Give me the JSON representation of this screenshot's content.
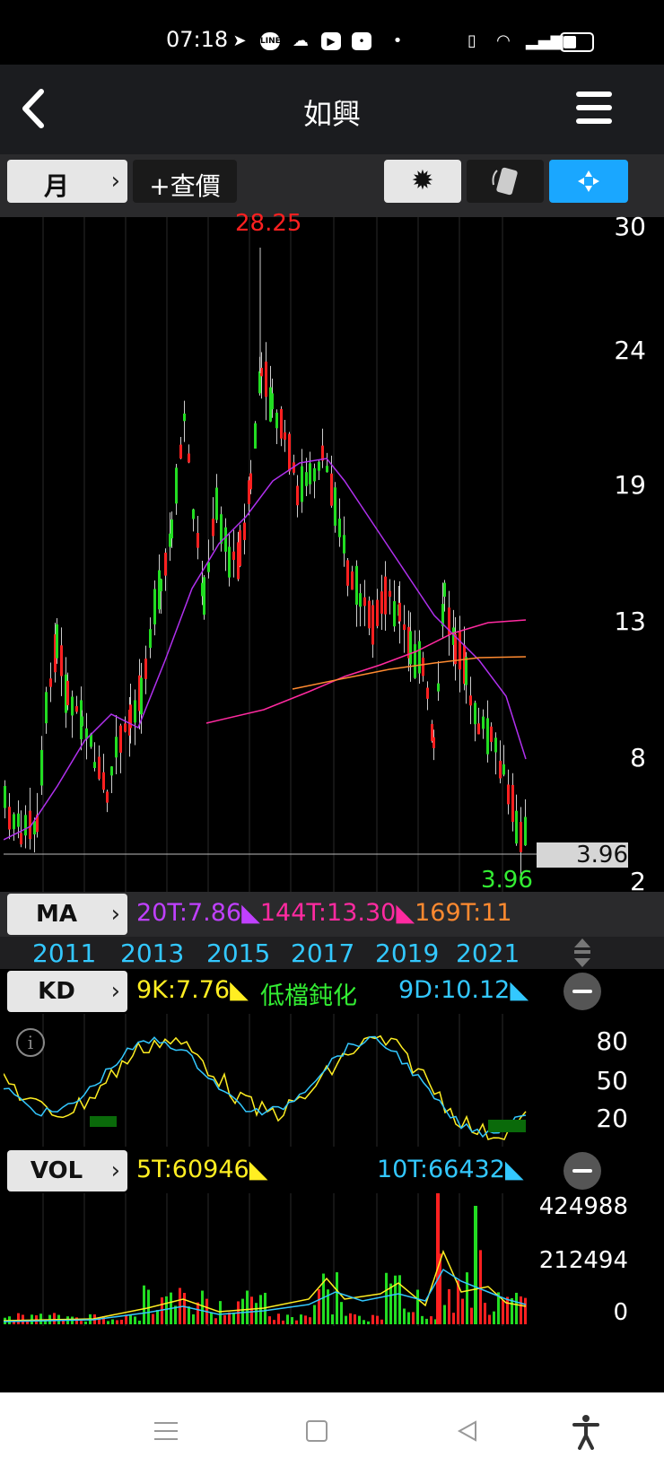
{
  "status": {
    "time": "07:18"
  },
  "header": {
    "title": "如興"
  },
  "toolbar": {
    "period_label": "月",
    "query_label": "+查價"
  },
  "price_chart": {
    "high_label": "28.25",
    "low_label": "3.96",
    "last_price": "3.96",
    "y_ticks": [
      "30",
      "24",
      "19",
      "13",
      "8",
      "2"
    ]
  },
  "ma": {
    "button_label": "MA",
    "values": [
      {
        "text": "20T:7.86",
        "color": "#c040ff"
      },
      {
        "text": "144T:13.30",
        "color": "#ff2aa0"
      },
      {
        "text": "169T:11",
        "color": "#ff8a30"
      }
    ]
  },
  "years": [
    "2011",
    "2013",
    "2015",
    "2017",
    "2019",
    "2021"
  ],
  "kd": {
    "button_label": "KD",
    "k_value": "9K:7.76",
    "status": "低檔鈍化",
    "d_value": "9D:10.12",
    "y_ticks": [
      "80",
      "50",
      "20"
    ]
  },
  "vol": {
    "button_label": "VOL",
    "ma5": "5T:60946",
    "ma10": "10T:66432",
    "y_ticks": [
      "424988",
      "212494",
      "0"
    ]
  },
  "colors": {
    "up": "#ff2020",
    "down": "#22dd22",
    "accent": "#1aa7ff",
    "yellow": "#ffee22",
    "cyan": "#33c8ff",
    "green_text": "#33ee33"
  },
  "icons": {
    "back": "chevron-left-icon",
    "menu": "hamburger-icon",
    "settings": "gear-icon",
    "rotate": "rotate-icon",
    "fullscreen": "shrink-icon"
  }
}
